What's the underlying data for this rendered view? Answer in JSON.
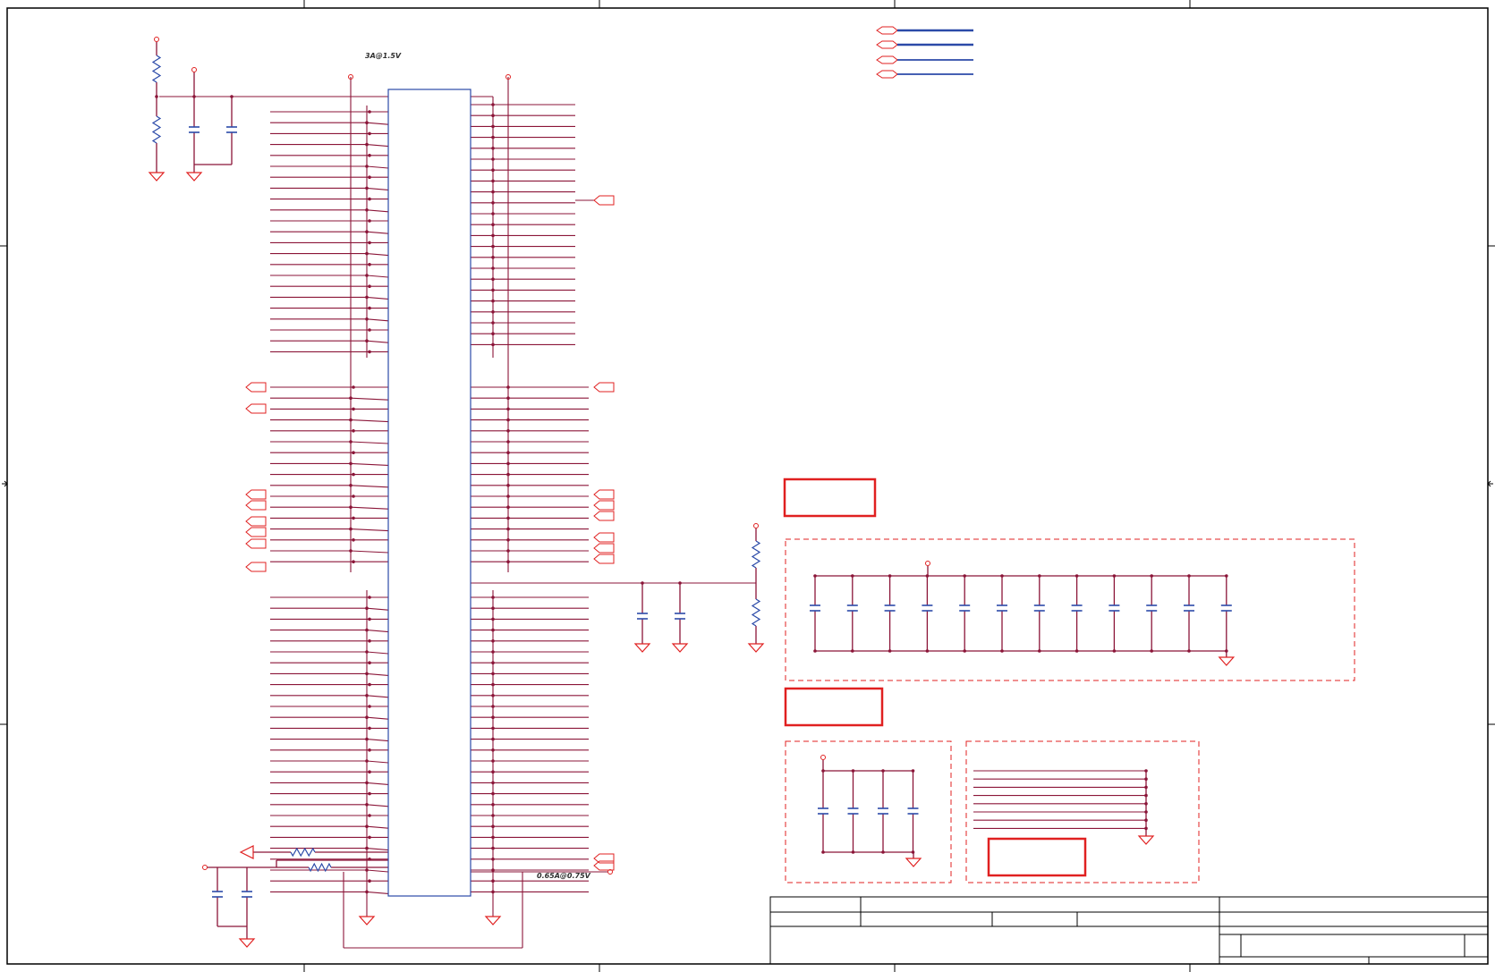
{
  "sheet": {
    "note_top": "3A@1.5V",
    "note_bottom": "0.65A@0.75V"
  },
  "colors": {
    "wire": "#8b1538",
    "part": "#2b4aa8",
    "power": "#e02020",
    "box": "#e02020",
    "border": "#000000"
  },
  "connector": {
    "icon": "ddr-sodimm-connector-icon",
    "top_left_pins": 23,
    "top_right_pins": 23,
    "middle_left_pins": 17,
    "middle_right_pins": 17,
    "bottom_left_pins": 28,
    "bottom_right_pins": 28
  },
  "decoupling": {
    "bulk_caps": 12,
    "small_caps": 4,
    "strap_lines": 8
  }
}
